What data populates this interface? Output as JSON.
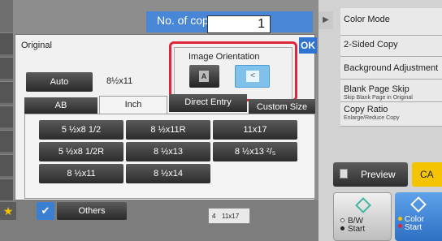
{
  "copies": {
    "label": "No. of copies",
    "value": "1"
  },
  "right_menu": [
    {
      "label": "Color Mode",
      "sub": ""
    },
    {
      "label": "2-Sided Copy",
      "sub": ""
    },
    {
      "label": "Background Adjustment",
      "sub": ""
    },
    {
      "label": "Blank Page Skip",
      "sub": "Skip Blank Page in Original"
    },
    {
      "label": "Copy Ratio",
      "sub": "Enlarge/Reduce Copy"
    }
  ],
  "actions": {
    "preview": "Preview",
    "ca": "CA",
    "bw_start": "B/W\nStart",
    "color_start": "Color\nStart"
  },
  "dialog": {
    "title": "Original",
    "ok": "OK",
    "orientation_label": "Image Orientation",
    "orientation_a_glyph": "A",
    "orientation_b_glyph": "<",
    "auto_label": "Auto",
    "auto_size": "8½x11"
  },
  "tabs": [
    "AB",
    "Inch",
    "Direct Entry",
    "Custom Size"
  ],
  "sizes": [
    "5 ½x8 1/2",
    "8 ½x11R",
    "11x17",
    "5 ½x8 1/2R",
    "8 ½x13",
    "8 ½x13 ²/₅",
    "8 ½x11",
    "8 ½x14"
  ],
  "bottom": {
    "others": "Others",
    "tray_number": "4",
    "tray_size": "11x17"
  },
  "colors": {
    "accent": "#2f74d0",
    "highlight": "#e0253b",
    "ca": "#f4c400",
    "selected": "#7fc1ea"
  },
  "icons": [
    "star-icon",
    "checkmark-icon",
    "preview-icon",
    "start-diamond-icon"
  ]
}
